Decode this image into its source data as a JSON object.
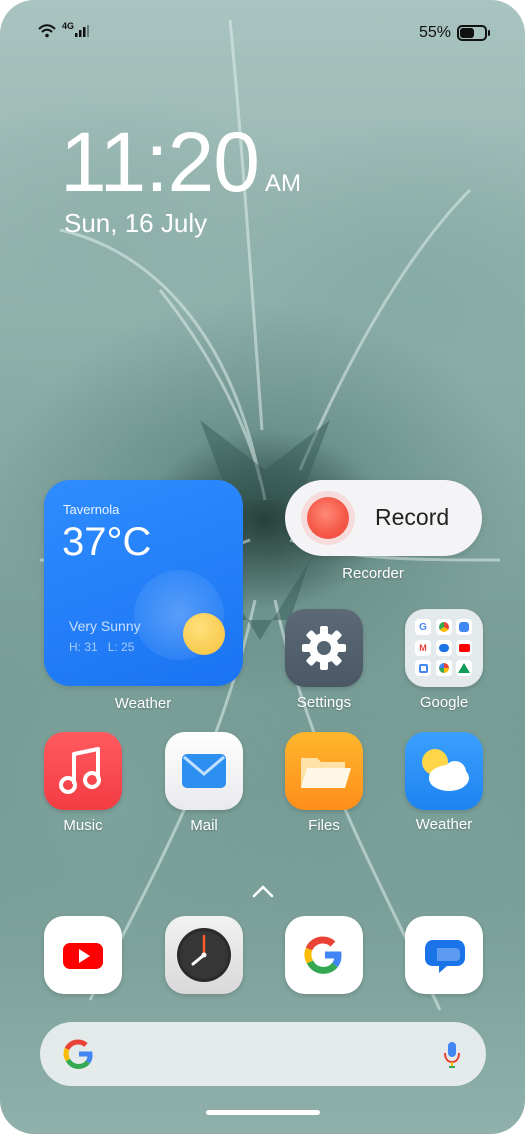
{
  "status_bar": {
    "network": "4G",
    "battery_percent": "55%",
    "battery_level": 0.55
  },
  "lock": {
    "time": "11:20",
    "ampm": "AM",
    "date": "Sun, 16 July"
  },
  "weather_widget": {
    "location": "Tavernola",
    "temperature": "37°C",
    "condition": "Very Sunny",
    "high": "H: 31",
    "low": "L: 25",
    "app_label": "Weather"
  },
  "recorder_widget": {
    "button_label": "Record",
    "app_label": "Recorder"
  },
  "apps": {
    "settings": "Settings",
    "google": "Google",
    "music": "Music",
    "mail": "Mail",
    "files": "Files",
    "weather": "Weather"
  },
  "dock": [
    "youtube-icon",
    "clock-icon",
    "google-icon",
    "messages-icon"
  ],
  "colors": {
    "weather_widget": "#1f7cf5",
    "record_dot": "#f55a4a",
    "music": "#f33c42",
    "files": "#ff9e22"
  }
}
